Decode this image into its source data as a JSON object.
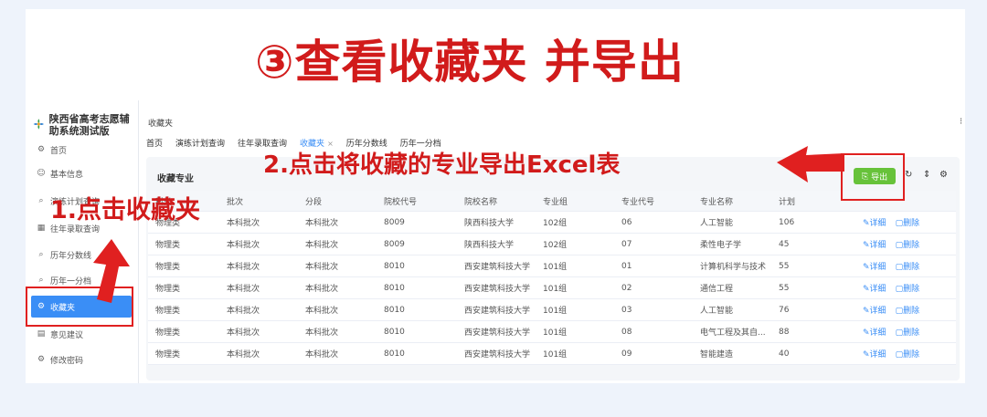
{
  "headline": {
    "num": "③",
    "text": "查看收藏夹 并导出"
  },
  "app": {
    "title": "陕西省高考志愿辅助系统测试版"
  },
  "sidebar": {
    "items": [
      {
        "label": "首页",
        "icon": "gear-icon"
      },
      {
        "label": "基本信息",
        "icon": "user-icon"
      },
      {
        "label": "演练计划查询",
        "icon": "search-icon"
      },
      {
        "label": "往年录取查询",
        "icon": "grid-icon"
      },
      {
        "label": "历年分数线",
        "icon": "search-icon"
      },
      {
        "label": "历年一分档",
        "icon": "search-icon"
      },
      {
        "label": "收藏夹",
        "icon": "gear-icon"
      },
      {
        "label": "意见建议",
        "icon": "document-icon"
      },
      {
        "label": "修改密码",
        "icon": "gear-icon"
      }
    ]
  },
  "breadcrumb": "收藏夹",
  "tabs": [
    {
      "label": "首页"
    },
    {
      "label": "演练计划查询"
    },
    {
      "label": "往年录取查询"
    },
    {
      "label": "收藏夹",
      "active": true,
      "close": "×"
    },
    {
      "label": "历年分数线"
    },
    {
      "label": "历年一分档"
    }
  ],
  "panel": {
    "title": "收藏专业",
    "export_label": "导出"
  },
  "table": {
    "headers": [
      "科类",
      "批次",
      "分段",
      "院校代号",
      "院校名称",
      "专业组",
      "专业代号",
      "专业名称",
      "计划",
      ""
    ],
    "rows": [
      [
        "物理类",
        "本科批次",
        "本科批次",
        "8009",
        "陕西科技大学",
        "102组",
        "06",
        "人工智能",
        "106"
      ],
      [
        "物理类",
        "本科批次",
        "本科批次",
        "8009",
        "陕西科技大学",
        "102组",
        "07",
        "柔性电子学",
        "45"
      ],
      [
        "物理类",
        "本科批次",
        "本科批次",
        "8010",
        "西安建筑科技大学",
        "101组",
        "01",
        "计算机科学与技术",
        "55"
      ],
      [
        "物理类",
        "本科批次",
        "本科批次",
        "8010",
        "西安建筑科技大学",
        "101组",
        "02",
        "通信工程",
        "55"
      ],
      [
        "物理类",
        "本科批次",
        "本科批次",
        "8010",
        "西安建筑科技大学",
        "101组",
        "03",
        "人工智能",
        "76"
      ],
      [
        "物理类",
        "本科批次",
        "本科批次",
        "8010",
        "西安建筑科技大学",
        "101组",
        "08",
        "电气工程及其自...",
        "88"
      ],
      [
        "物理类",
        "本科批次",
        "本科批次",
        "8010",
        "西安建筑科技大学",
        "101组",
        "09",
        "智能建造",
        "40"
      ]
    ],
    "detail_label": "详细",
    "delete_label": "删除"
  },
  "annotations": {
    "step1": "1.点击收藏夹",
    "step2": "2.点击将收藏的专业导出Excel表"
  },
  "colors": {
    "accent": "#3a8ef6",
    "export": "#67c23a",
    "annotation": "#d11b1b"
  }
}
